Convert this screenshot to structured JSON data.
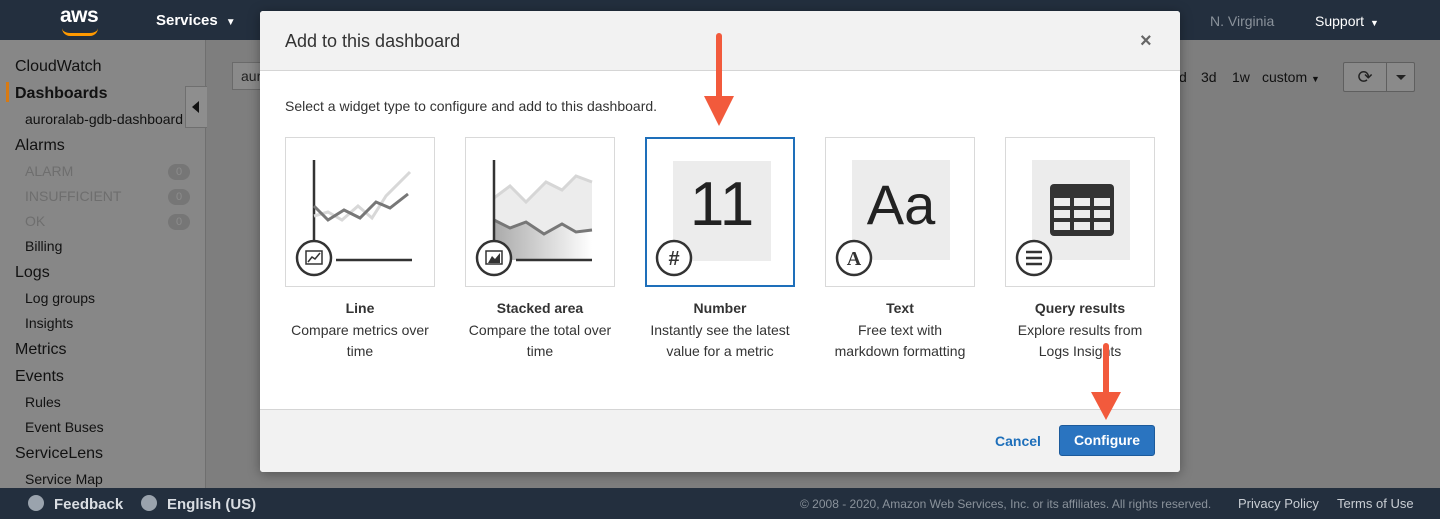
{
  "topnav": {
    "logo": "aws",
    "services_label": "Services",
    "region_label": "N. Virginia",
    "support_label": "Support"
  },
  "sidebar": {
    "items": [
      {
        "label": "CloudWatch"
      },
      {
        "label": "Dashboards"
      },
      {
        "label": "auroralab-gdb-dashboard"
      },
      {
        "label": "Alarms"
      },
      {
        "label": "ALARM",
        "count": "0"
      },
      {
        "label": "INSUFFICIENT",
        "count": "0"
      },
      {
        "label": "OK",
        "count": "0"
      },
      {
        "label": "Billing"
      },
      {
        "label": "Logs"
      },
      {
        "label": "Log groups"
      },
      {
        "label": "Insights"
      },
      {
        "label": "Metrics"
      },
      {
        "label": "Events"
      },
      {
        "label": "Rules"
      },
      {
        "label": "Event Buses"
      },
      {
        "label": "ServiceLens"
      },
      {
        "label": "Service Map"
      }
    ]
  },
  "background": {
    "dashboard_select": "aur",
    "time_options": [
      "d",
      "3d",
      "1w",
      "custom"
    ]
  },
  "modal": {
    "title": "Add to this dashboard",
    "close": "×",
    "instruction": "Select a widget type to configure and add to this dashboard.",
    "widgets": [
      {
        "title": "Line",
        "desc_1": "Compare metrics over",
        "desc_2": "time",
        "icon": "line-chart-icon"
      },
      {
        "title": "Stacked area",
        "desc_1": "Compare the total over",
        "desc_2": "time",
        "icon": "area-chart-icon"
      },
      {
        "title": "Number",
        "desc_1": "Instantly see the latest",
        "desc_2": "value for a metric",
        "preview": "11",
        "icon": "hash-icon"
      },
      {
        "title": "Text",
        "desc_1": "Free text with",
        "desc_2": "markdown formatting",
        "preview": "Aa",
        "icon": "text-a-icon"
      },
      {
        "title": "Query results",
        "desc_1": "Explore results from",
        "desc_2": "Logs Insights",
        "icon": "list-icon"
      }
    ],
    "cancel_label": "Cancel",
    "configure_label": "Configure"
  },
  "footer": {
    "feedback": "Feedback",
    "language": "English (US)",
    "copyright": "© 2008 - 2020, Amazon Web Services, Inc. or its affiliates. All rights reserved.",
    "privacy": "Privacy Policy",
    "terms": "Terms of Use"
  },
  "colors": {
    "nav_bg": "#232f3e",
    "accent_orange": "#ff9900",
    "primary_blue": "#2a74c0",
    "annotation_arrow": "#f25a3c"
  }
}
